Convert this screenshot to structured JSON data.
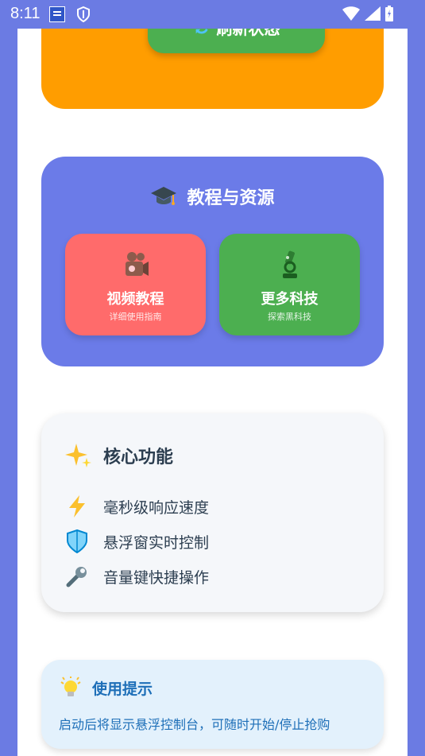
{
  "status_bar": {
    "time": "8:11",
    "icons": [
      "news-icon",
      "shield-icon",
      "wifi-icon",
      "signal-icon",
      "battery-icon"
    ]
  },
  "refresh": {
    "label": "刷新状态",
    "icon": "refresh-icon",
    "card_color": "#ff9d00",
    "button_color": "#4caf50"
  },
  "tutorial": {
    "title": "教程与资源",
    "icon": "graduation-cap-icon",
    "card_color": "#6b7be8",
    "tiles": [
      {
        "label": "视频教程",
        "sub": "详细使用指南",
        "icon": "video-camera-icon",
        "color": "#ff6b6b"
      },
      {
        "label": "更多科技",
        "sub": "探索黑科技",
        "icon": "microscope-icon",
        "color": "#4caf50"
      }
    ]
  },
  "features": {
    "title": "核心功能",
    "icon": "sparkles-icon",
    "items": [
      {
        "label": "毫秒级响应速度",
        "icon": "lightning-icon"
      },
      {
        "label": "悬浮窗实时控制",
        "icon": "shield-icon"
      },
      {
        "label": "音量键快捷操作",
        "icon": "wrench-icon"
      }
    ]
  },
  "tip": {
    "title": "使用提示",
    "icon": "lightbulb-icon",
    "text": "启动后将显示悬浮控制台，可随时开始/停止抢购"
  }
}
